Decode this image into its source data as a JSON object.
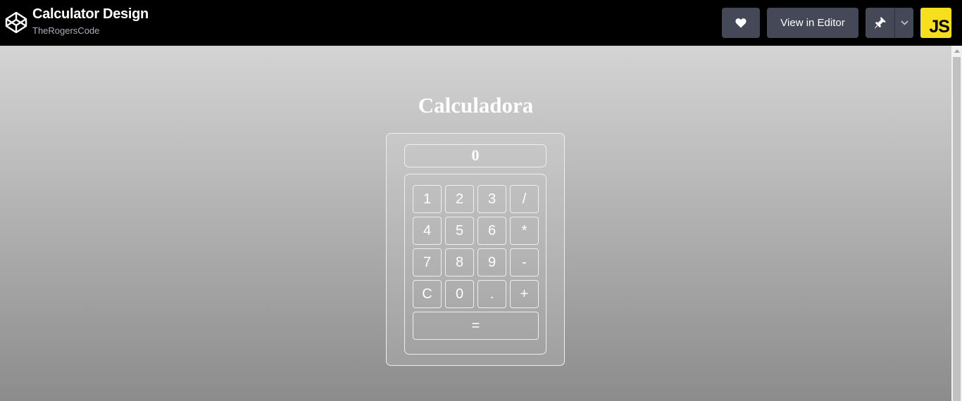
{
  "header": {
    "title": "Calculator Design",
    "author": "TheRogersCode",
    "view_editor_label": "View in Editor",
    "js_badge": "JS",
    "heart_icon": "heart-icon",
    "pin_icon": "pin-icon",
    "chevron_icon": "chevron-down-icon",
    "accent_js": "#f7df1e",
    "button_bg": "#444857"
  },
  "calculator": {
    "heading": "Calculadora",
    "display_value": "0",
    "keys": [
      [
        "1",
        "2",
        "3",
        "/"
      ],
      [
        "4",
        "5",
        "6",
        "*"
      ],
      [
        "7",
        "8",
        "9",
        "-"
      ],
      [
        "C",
        "0",
        ".",
        "+"
      ]
    ],
    "equals": "="
  }
}
